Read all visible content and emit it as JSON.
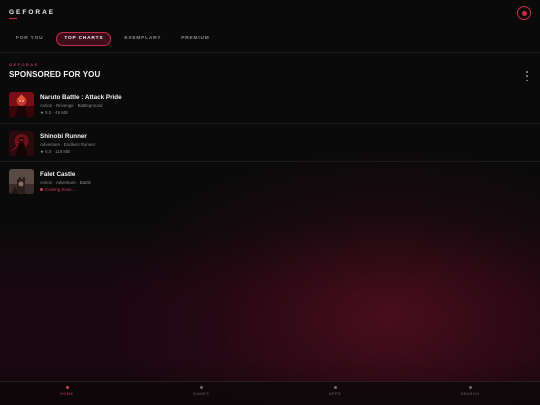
{
  "header": {
    "brand": "GEFORAE"
  },
  "tabs": [
    {
      "label": "FOR YOU",
      "active": false
    },
    {
      "label": "TOP CHARTS",
      "active": true
    },
    {
      "label": "EXEMPLARY",
      "active": false
    },
    {
      "label": "PREMIUM",
      "active": false
    }
  ],
  "section": {
    "eyebrow": "GEFORAE",
    "title": "SPONSORED FOR YOU"
  },
  "apps": [
    {
      "title": "Naruto Battle : Attack Pride",
      "genres": "Action · Revenge · Battleground",
      "rating": "★ 5.0 · 45 MB",
      "icon": "naruto-thumbnail"
    },
    {
      "title": "Shinobi Runner",
      "genres": "Adventure · Endless Runner",
      "rating": "★ 5.0 · 118 MB",
      "icon": "shinobi-thumbnail"
    },
    {
      "title": "Falet Castle",
      "genres": "Action · Adventure · Battle",
      "status": "Coming Soon...",
      "icon": "castle-thumbnail"
    }
  ],
  "nav": [
    {
      "label": "HOME",
      "active": true,
      "icon": "home-dot-icon"
    },
    {
      "label": "GAMES",
      "active": false,
      "icon": "games-dot-icon"
    },
    {
      "label": "APPS",
      "active": false,
      "icon": "apps-dot-icon"
    },
    {
      "label": "SEARCH",
      "active": false,
      "icon": "search-dot-icon"
    }
  ],
  "colors": {
    "accent": "#c82b4d",
    "background": "#0a0a0b"
  }
}
